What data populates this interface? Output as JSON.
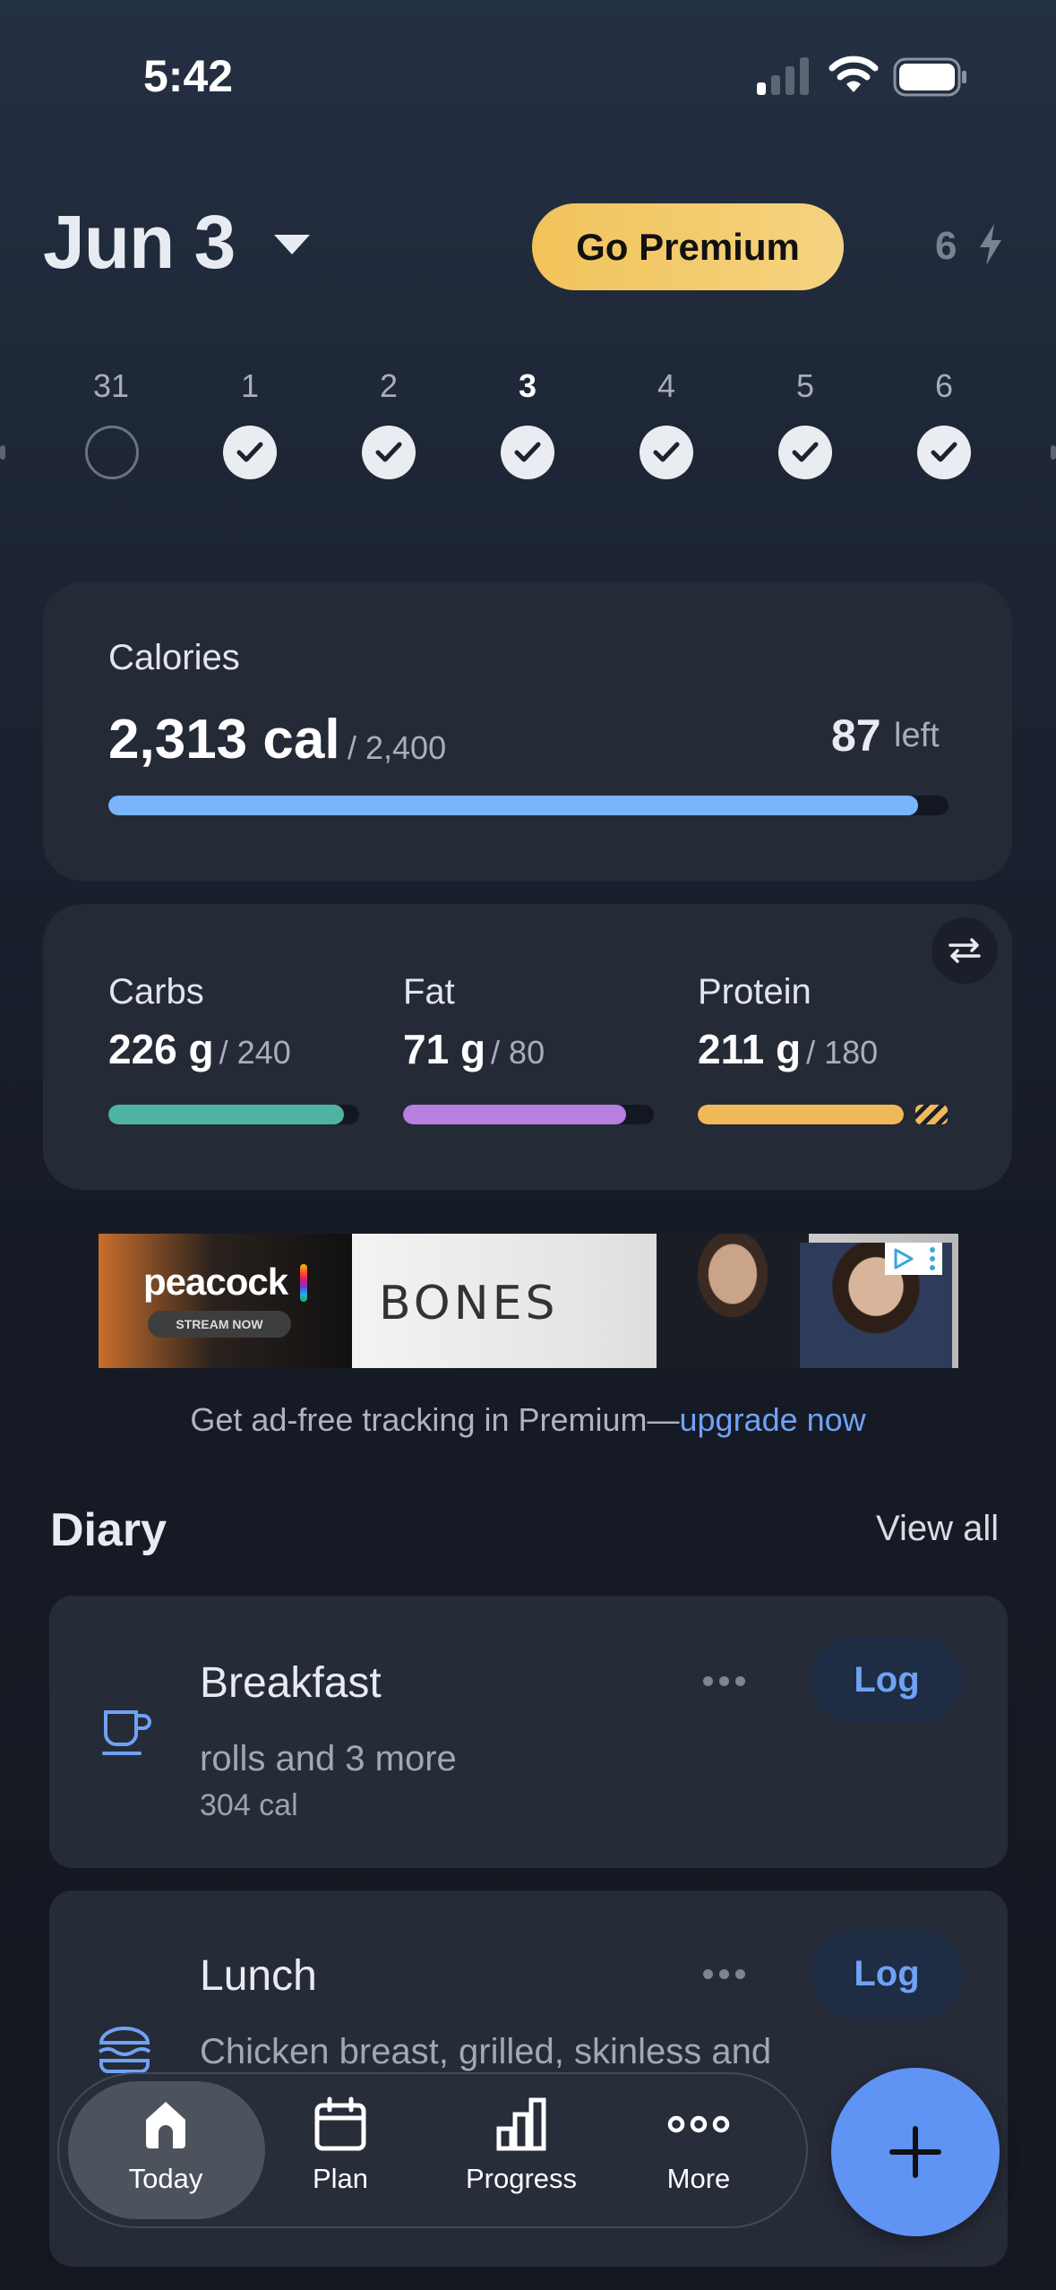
{
  "status_bar": {
    "time": "5:42"
  },
  "header": {
    "date_title": "Jun 3",
    "premium_label": "Go Premium",
    "streak_count": "6"
  },
  "week": [
    {
      "label": "31",
      "done": false,
      "selected": false
    },
    {
      "label": "1",
      "done": true,
      "selected": false
    },
    {
      "label": "2",
      "done": true,
      "selected": false
    },
    {
      "label": "3",
      "done": true,
      "selected": true
    },
    {
      "label": "4",
      "done": true,
      "selected": false
    },
    {
      "label": "5",
      "done": true,
      "selected": false
    },
    {
      "label": "6",
      "done": true,
      "selected": false
    }
  ],
  "calories": {
    "label": "Calories",
    "value": "2,313 cal",
    "goal": "/ 2,400",
    "left_value": "87",
    "left_label": "left",
    "progress": 0.964
  },
  "macros": [
    {
      "name": "Carbs",
      "value": "226 g",
      "goal": "/ 240",
      "progress": 0.94,
      "color": "#4fb3a2"
    },
    {
      "name": "Fat",
      "value": "71 g",
      "goal": "/ 80",
      "progress": 0.89,
      "color": "#b67fe0"
    },
    {
      "name": "Protein",
      "value": "211 g",
      "goal": "/ 180",
      "progress": 1.0,
      "color": "#f1b85a"
    }
  ],
  "ad": {
    "brand": "peacock",
    "stream_label": "STREAM NOW",
    "show_title": "BONES",
    "cta_text": "Get ad-free tracking in Premium—",
    "cta_link": "upgrade now"
  },
  "diary": {
    "title": "Diary",
    "view_all": "View all",
    "meals": [
      {
        "name": "Breakfast",
        "desc": "rolls and 3 more",
        "cal": "304 cal",
        "log": "Log",
        "icon": "cup-icon"
      },
      {
        "name": "Lunch",
        "desc": "Chicken breast, grilled, skinless and",
        "log": "Log",
        "icon": "burger-icon"
      }
    ]
  },
  "nav": {
    "tabs": [
      {
        "label": "Today",
        "icon": "home-icon",
        "active": true
      },
      {
        "label": "Plan",
        "icon": "calendar-icon",
        "active": false
      },
      {
        "label": "Progress",
        "icon": "bar-chart-icon",
        "active": false
      },
      {
        "label": "More",
        "icon": "more-icon",
        "active": false
      }
    ],
    "fab_icon": "plus-icon"
  },
  "colors": {
    "accent": "#6fa2f4",
    "calorie_bar": "#7ab5fb",
    "premium": "#f2c35a",
    "fab": "#5f94f5"
  }
}
